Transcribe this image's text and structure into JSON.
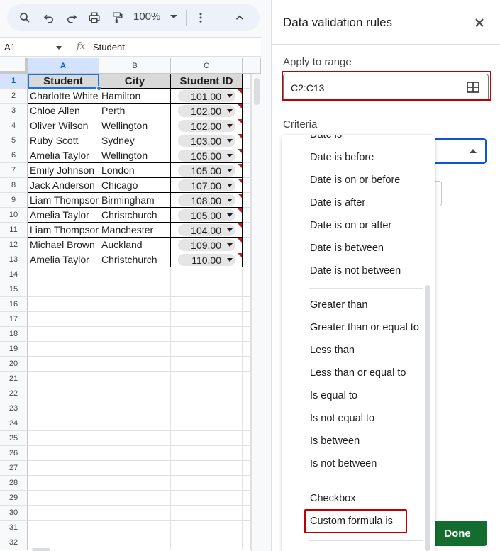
{
  "toolbar": {
    "zoom": "100%"
  },
  "formula_bar": {
    "name_box": "A1",
    "fx": "fx",
    "content": "Student"
  },
  "sheet": {
    "columns": [
      "A",
      "B",
      "C"
    ],
    "header": [
      "Student",
      "City",
      "Student ID"
    ],
    "rows": [
      {
        "student": "Charlotte White",
        "city": "Hamilton",
        "id": "101.00"
      },
      {
        "student": "Chloe Allen",
        "city": "Perth",
        "id": "102.00"
      },
      {
        "student": "Oliver Wilson",
        "city": "Wellington",
        "id": "102.00"
      },
      {
        "student": "Ruby Scott",
        "city": "Sydney",
        "id": "103.00"
      },
      {
        "student": "Amelia Taylor",
        "city": "Wellington",
        "id": "105.00"
      },
      {
        "student": "Emily Johnson",
        "city": "London",
        "id": "105.00"
      },
      {
        "student": "Jack Anderson",
        "city": "Chicago",
        "id": "107.00"
      },
      {
        "student": "Liam Thompson",
        "city": "Birmingham",
        "id": "108.00"
      },
      {
        "student": "Amelia Taylor",
        "city": "Christchurch",
        "id": "105.00"
      },
      {
        "student": "Liam Thompson",
        "city": "Manchester",
        "id": "104.00"
      },
      {
        "student": "Michael Brown",
        "city": "Auckland",
        "id": "109.00"
      },
      {
        "student": "Amelia Taylor",
        "city": "Christchurch",
        "id": "110.00"
      }
    ],
    "row_numbers": [
      "1",
      "2",
      "3",
      "4",
      "5",
      "6",
      "7",
      "8",
      "9",
      "10",
      "11",
      "12",
      "13",
      "14",
      "15",
      "16",
      "17",
      "18",
      "19",
      "20",
      "21",
      "22",
      "23",
      "24",
      "25",
      "26",
      "27",
      "28",
      "29",
      "30",
      "31",
      "32"
    ]
  },
  "panel": {
    "title": "Data validation rules",
    "apply_label": "Apply to range",
    "range_value": "C2:C13",
    "criteria_label": "Criteria",
    "done_label": "Done"
  },
  "menu": {
    "group1": [
      "Date is",
      "Date is before",
      "Date is on or before",
      "Date is after",
      "Date is on or after",
      "Date is between",
      "Date is not between"
    ],
    "group2": [
      "Greater than",
      "Greater than or equal to",
      "Less than",
      "Less than or equal to",
      "Is equal to",
      "Is not equal to",
      "Is between",
      "Is not between"
    ],
    "group3": [
      "Checkbox",
      "Custom formula is"
    ]
  },
  "colors": {
    "accent": "#0b57d0",
    "done_button": "#146c2e",
    "highlight_box": "#c00000"
  }
}
